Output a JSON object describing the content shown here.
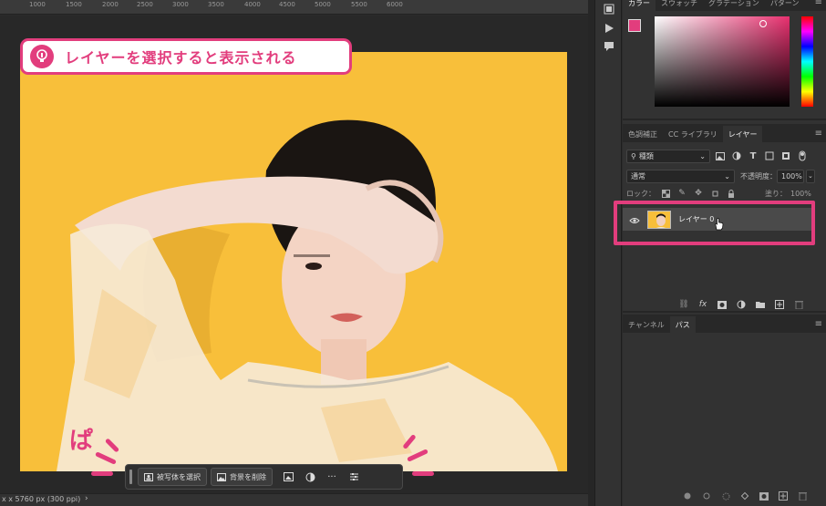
{
  "ruler": {
    "ticks": [
      "1000",
      "1500",
      "2000",
      "2500",
      "3000",
      "3500",
      "4000",
      "4500",
      "5000",
      "5500",
      "6000"
    ]
  },
  "callout": {
    "text": "レイヤーを選択すると表示される",
    "icon": "lightbulb-icon"
  },
  "taskbar": {
    "select_subject": "被写体を選択",
    "remove_background": "背景を削除",
    "more": "···"
  },
  "annotation": {
    "pa": "ぱ"
  },
  "statusbar": {
    "text": "x x 5760 px (300 ppi)",
    "chevron": "›"
  },
  "color_panel": {
    "tabs": [
      "カラー",
      "スウォッチ",
      "グラデーション",
      "パターン"
    ],
    "foreground": "#e23d7d",
    "background": "#ffffff"
  },
  "layers_panel": {
    "tabs": [
      "色調補正",
      "CC ライブラリ",
      "レイヤー"
    ],
    "filter_label": "種類",
    "blend_mode": "通常",
    "opacity_label": "不透明度：",
    "opacity_value": "100%",
    "lock_label": "ロック：",
    "fill_label": "塗り：",
    "fill_value": "100%",
    "layer_name": "レイヤー 0"
  },
  "paths_panel": {
    "tabs": [
      "チャンネル",
      "パス"
    ]
  },
  "colors": {
    "accent": "#e23d7d",
    "photo_bg": "#f8bf3a"
  }
}
